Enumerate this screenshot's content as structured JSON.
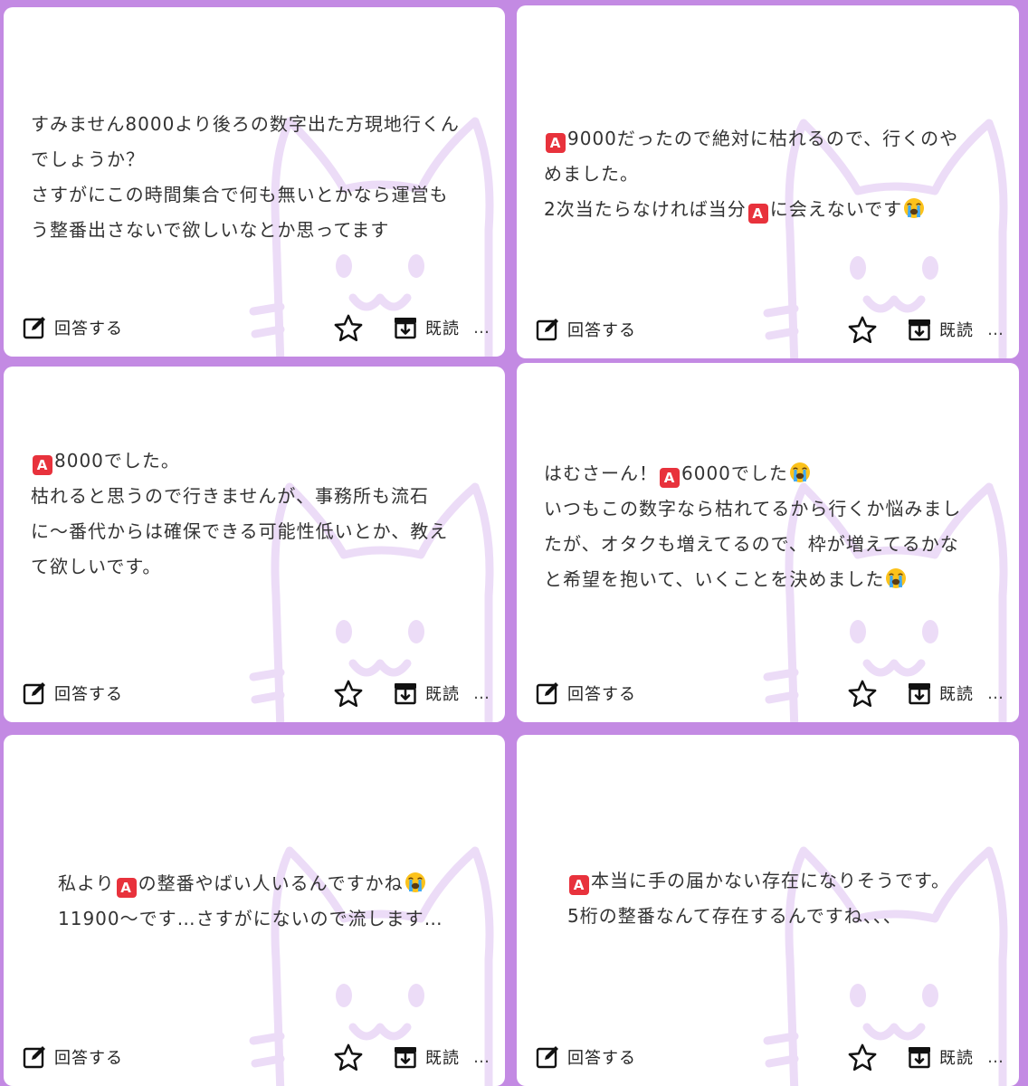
{
  "cards": [
    {
      "segments": [
        {
          "t": "text",
          "v": "すみません8000より後ろの数字出た方現地行くん\nでしょうか？\nさすがにこの時間集合で何も無いとかなら運営も\nう整番出さないで欲しいなとか思ってます"
        }
      ],
      "answer_label": "回答する",
      "read_label": "既読",
      "more_label": "…"
    },
    {
      "segments": [
        {
          "t": "badge",
          "v": "A"
        },
        {
          "t": "text",
          "v": "9000だったので絶対に枯れるので、行くのや\nめました。\n2次当たらなければ当分"
        },
        {
          "t": "badge",
          "v": "A"
        },
        {
          "t": "text",
          "v": "に会えないです"
        },
        {
          "t": "emoji",
          "v": "loudly-crying-face"
        }
      ],
      "answer_label": "回答する",
      "read_label": "既読",
      "more_label": "…"
    },
    {
      "segments": [
        {
          "t": "badge",
          "v": "A"
        },
        {
          "t": "text",
          "v": "8000でした。\n枯れると思うので行きませんが、事務所も流石\nに〜番代からは確保できる可能性低いとか、教え\nて欲しいです。"
        }
      ],
      "answer_label": "回答する",
      "read_label": "既読",
      "more_label": "…"
    },
    {
      "segments": [
        {
          "t": "text",
          "v": "はむさーん！"
        },
        {
          "t": "badge",
          "v": "A"
        },
        {
          "t": "text",
          "v": "6000でした"
        },
        {
          "t": "emoji",
          "v": "loudly-crying-face"
        },
        {
          "t": "text",
          "v": "\nいつもこの数字なら枯れてるから行くか悩みまし\nたが、オタクも増えてるので、枠が増えてるかな\nと希望を抱いて、いくことを決めました"
        },
        {
          "t": "emoji",
          "v": "loudly-crying-face"
        }
      ],
      "answer_label": "回答する",
      "read_label": "既読",
      "more_label": "…"
    },
    {
      "segments": [
        {
          "t": "text",
          "v": "私より"
        },
        {
          "t": "badge",
          "v": "A"
        },
        {
          "t": "text",
          "v": "の整番やばい人いるんですかね"
        },
        {
          "t": "emoji",
          "v": "loudly-crying-face"
        },
        {
          "t": "text",
          "v": "\n11900〜です…さすがにないので流します…"
        }
      ],
      "answer_label": "回答する",
      "read_label": "既読",
      "more_label": "…"
    },
    {
      "segments": [
        {
          "t": "badge",
          "v": "A"
        },
        {
          "t": "text",
          "v": "本当に手の届かない存在になりそうです。\n5桁の整番なんて存在するんですね、、、"
        }
      ],
      "answer_label": "回答する",
      "read_label": "既読",
      "more_label": "…"
    }
  ],
  "colors": {
    "background": "#c38ae3",
    "card": "#ffffff",
    "badge": "#e8323c",
    "watermark": "#ecdcf7",
    "text": "#333333"
  },
  "icons": {
    "answer": "edit-icon",
    "favorite": "star-icon",
    "read": "archive-icon",
    "more": "more-icon",
    "watermark": "cat-watermark-icon"
  }
}
